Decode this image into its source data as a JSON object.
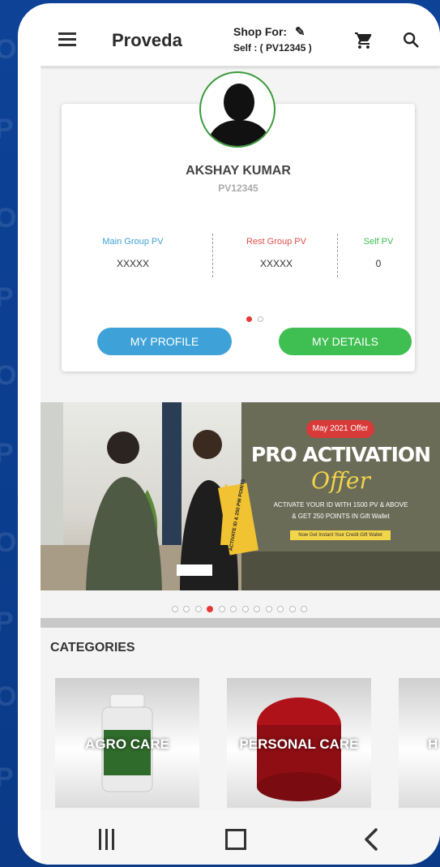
{
  "appbar": {
    "brand": "Proveda",
    "shop_for_label": "Shop For:",
    "shop_for_value": "Self : ( PV12345 )"
  },
  "profile": {
    "name": "AKSHAY KUMAR",
    "id": "PV12345",
    "stats": [
      {
        "label": "Main Group PV",
        "value": "XXXXX",
        "color": "#3ea2d8"
      },
      {
        "label": "Rest Group PV",
        "value": "XXXXX",
        "color": "#e0504a"
      },
      {
        "label": "Self PV",
        "value": "0",
        "color": "#3fbf52"
      }
    ],
    "buttons": {
      "profile": "MY PROFILE",
      "details": "MY DETAILS"
    }
  },
  "banner": {
    "tag": "May 2021 Offer",
    "title": "PRO ACTIVATION",
    "script": "Offer",
    "line1": "ACTIVATE YOUR ID WITH 1500 PV & ABOVE",
    "line2": "& GET 250 POINTS IN Gift Wallet",
    "strip": "Now Get Instant Your Credit Gift Wallet",
    "badge": "ACTIVATE ID & 250 PW POINTS",
    "dot_count": 12,
    "active_dot": 3
  },
  "categories": {
    "title": "CATEGORIES",
    "items": [
      {
        "label": "AGRO CARE"
      },
      {
        "label": "PERSONAL CARE"
      },
      {
        "label": "H"
      }
    ]
  },
  "colors": {
    "brand_blue": "#0b3e8f",
    "accent_red": "#e53935",
    "profile_button": "#3ea2d8",
    "details_button": "#3fbf52"
  }
}
